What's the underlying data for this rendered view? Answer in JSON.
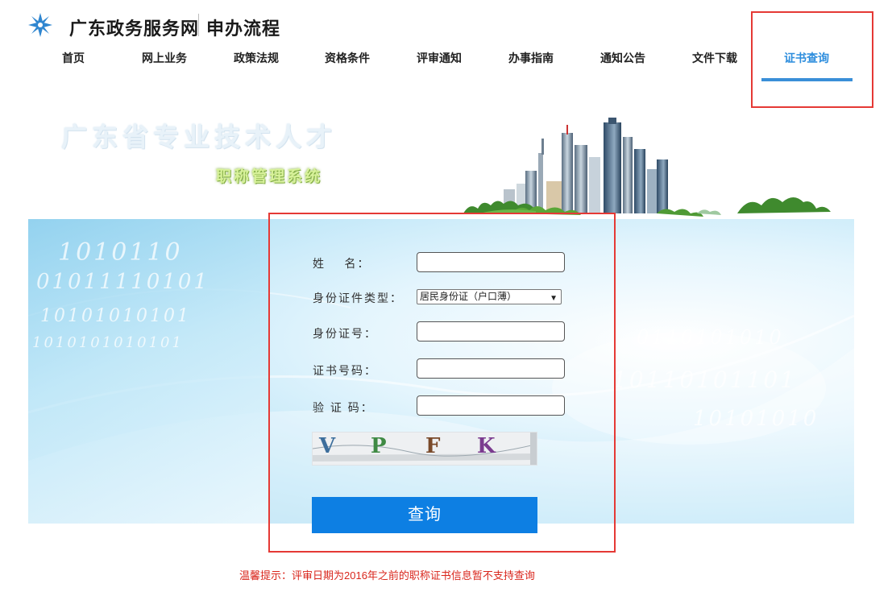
{
  "header": {
    "site_name": "广东政务服务网",
    "sub_name": "申办流程"
  },
  "nav": {
    "items": [
      {
        "label": "首页"
      },
      {
        "label": "网上业务"
      },
      {
        "label": "政策法规"
      },
      {
        "label": "资格条件"
      },
      {
        "label": "评审通知"
      },
      {
        "label": "办事指南"
      },
      {
        "label": "通知公告"
      },
      {
        "label": "文件下载"
      },
      {
        "label": "证书查询"
      }
    ],
    "active": "证书查询"
  },
  "banner": {
    "line1": "广东省专业技术人才",
    "line2": "职称管理系统"
  },
  "form": {
    "name_label": "姓    名：",
    "name_value": "",
    "id_type_label": "身份证件类型：",
    "id_type_selected": "居民身份证（户口薄）",
    "id_number_label": "身份证号：",
    "id_number_value": "",
    "cert_number_label": "证书号码：",
    "cert_number_value": "",
    "captcha_label": "验 证 码：",
    "captcha_value": "",
    "captcha_text": "VPFK",
    "query_button": "查询"
  },
  "tip": "温馨提示：评审日期为2016年之前的职称证书信息暂不支持查询",
  "colors": {
    "accent": "#2d8ddd",
    "button": "#0d7fe3",
    "highlight": "#e53935",
    "tip": "#d9261c"
  }
}
